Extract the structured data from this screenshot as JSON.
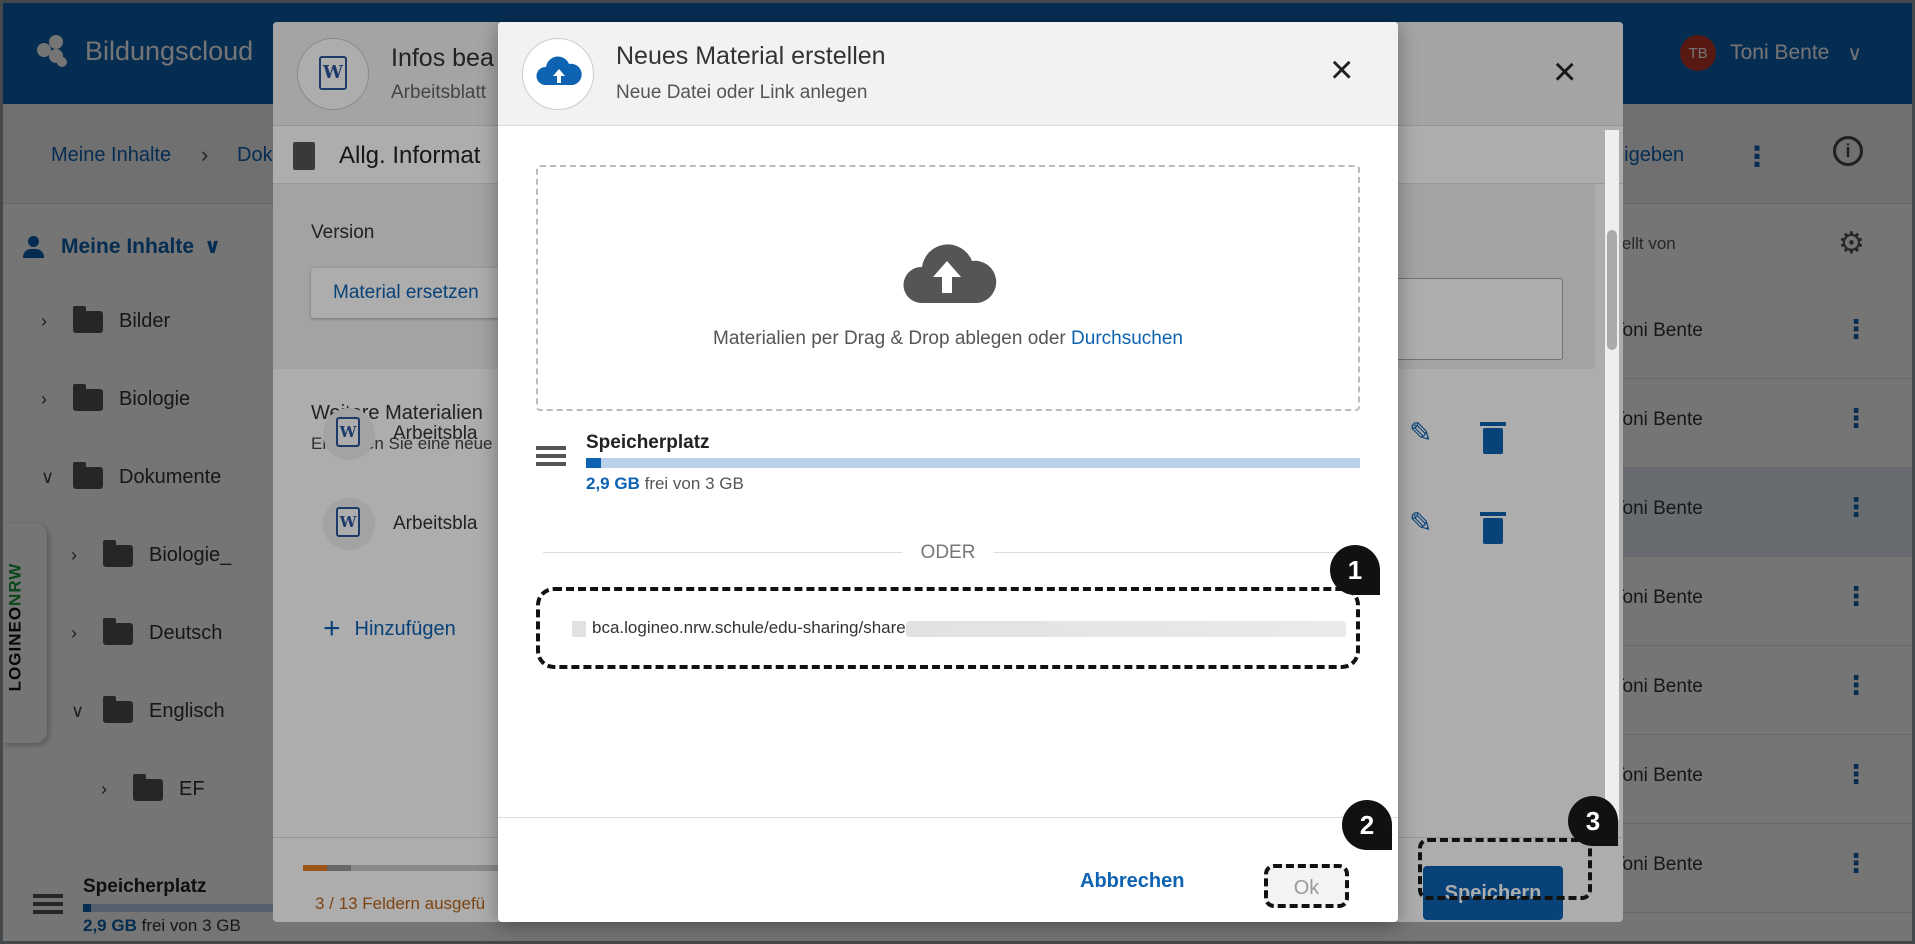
{
  "app": {
    "brand": "Bildungscloud",
    "user_initials": "TB",
    "user_name": "Toni Bente",
    "breadcrumbs": [
      "Meine Inhalte",
      "Dok"
    ],
    "freigeben": "eigeben",
    "sidebar": {
      "title": "Meine Inhalte",
      "items": [
        {
          "label": "Bilder",
          "expanded": false
        },
        {
          "label": "Biologie",
          "expanded": false
        },
        {
          "label": "Dokumente",
          "expanded": true
        },
        {
          "label": "Biologie_",
          "expanded": false
        },
        {
          "label": "Deutsch",
          "expanded": false
        },
        {
          "label": "Englisch",
          "expanded": true
        },
        {
          "label": "EF",
          "expanded": false
        }
      ],
      "storage": {
        "label": "Speicherplatz",
        "free": "2,9 GB",
        "of": "frei von 3 GB"
      }
    },
    "table": {
      "header": "rstellt von",
      "rows": [
        "Toni Bente",
        "Toni Bente",
        "Toni Bente",
        "Toni Bente",
        "Toni Bente",
        "Toni Bente",
        "Toni Bente"
      ]
    },
    "logineo": {
      "part1": "LOGINEO",
      "part2": "NRW"
    }
  },
  "edit_dialog": {
    "title": "Infos bea",
    "subtitle": "Arbeitsblatt",
    "section": "Allg. Informat",
    "version_label": "Version",
    "replace_button": "Material ersetzen",
    "more_title": "Weitere Materialien",
    "more_sub": "Erzeugen Sie eine neue",
    "files": [
      "Arbeitsbla",
      "Arbeitsbla"
    ],
    "add": "Hinzufügen",
    "fields_status": "3 / 13 Feldern ausgefü",
    "progress": 0.08,
    "save": "Speichern"
  },
  "new_dialog": {
    "title": "Neues Material erstellen",
    "subtitle": "Neue Datei oder Link anlegen",
    "drop_text": "Materialien per Drag & Drop ablegen oder",
    "browse": "Durchsuchen",
    "storage_label": "Speicherplatz",
    "storage_free": "2,9 GB",
    "storage_of": "frei von 3 GB",
    "storage_used_fraction": 0.02,
    "divider": "ODER",
    "url_value": "bca.logineo.nrw.schule/edu-sharing/share",
    "cancel": "Abbrechen",
    "ok": "Ok"
  },
  "markers": [
    "1",
    "2",
    "3"
  ],
  "colors": {
    "primary": "#0d62b1",
    "accent_orange": "#e67e22",
    "logineo_green": "#1c9b3b"
  }
}
